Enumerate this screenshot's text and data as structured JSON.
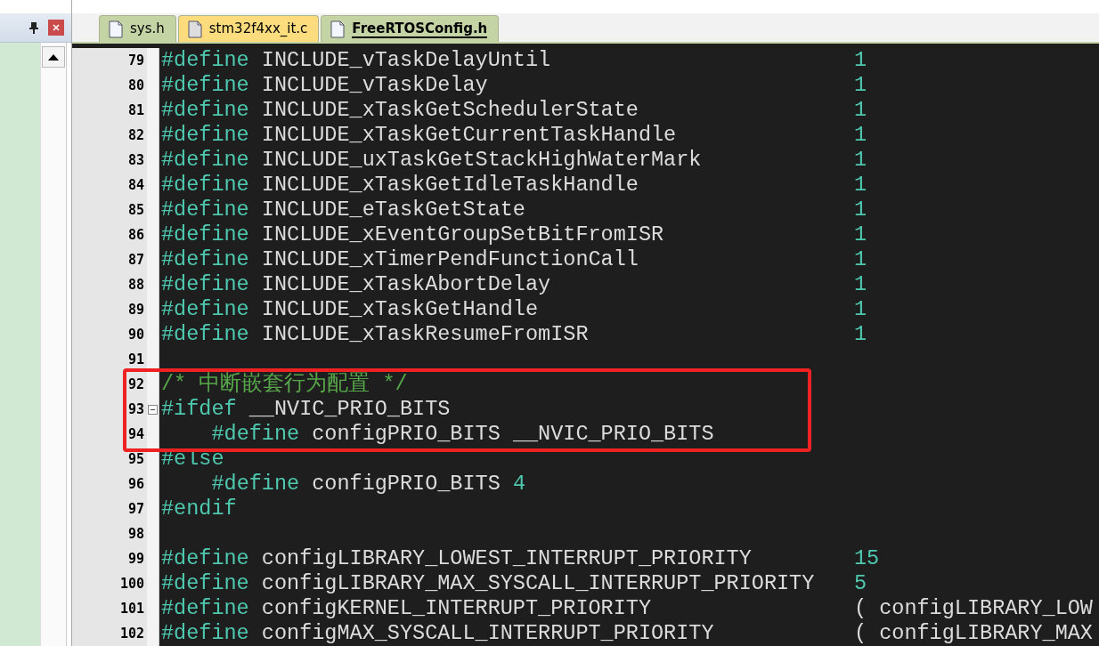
{
  "tabs": [
    {
      "label": "sys.h",
      "selected": false,
      "color": "#c4d4a4"
    },
    {
      "label": "stm32f4xx_it.c",
      "selected": false,
      "color": "#fcdc7c"
    },
    {
      "label": "FreeRTOSConfig.h",
      "selected": true,
      "color": "#c4d4a4"
    }
  ],
  "lines": [
    {
      "number": "79",
      "kind": "define",
      "directive": "#define",
      "name": "INCLUDE_vTaskDelayUntil",
      "value": "1",
      "indented": false,
      "value_inline": false
    },
    {
      "number": "80",
      "kind": "define",
      "directive": "#define",
      "name": "INCLUDE_vTaskDelay",
      "value": "1",
      "indented": false,
      "value_inline": false
    },
    {
      "number": "81",
      "kind": "define",
      "directive": "#define",
      "name": "INCLUDE_xTaskGetSchedulerState",
      "value": "1",
      "indented": false,
      "value_inline": false
    },
    {
      "number": "82",
      "kind": "define",
      "directive": "#define",
      "name": "INCLUDE_xTaskGetCurrentTaskHandle",
      "value": "1",
      "indented": false,
      "value_inline": false
    },
    {
      "number": "83",
      "kind": "define",
      "directive": "#define",
      "name": "INCLUDE_uxTaskGetStackHighWaterMark",
      "value": "1",
      "indented": false,
      "value_inline": false
    },
    {
      "number": "84",
      "kind": "define",
      "directive": "#define",
      "name": "INCLUDE_xTaskGetIdleTaskHandle",
      "value": "1",
      "indented": false,
      "value_inline": false
    },
    {
      "number": "85",
      "kind": "define",
      "directive": "#define",
      "name": "INCLUDE_eTaskGetState",
      "value": "1",
      "indented": false,
      "value_inline": false
    },
    {
      "number": "86",
      "kind": "define",
      "directive": "#define",
      "name": "INCLUDE_xEventGroupSetBitFromISR",
      "value": "1",
      "indented": false,
      "value_inline": false
    },
    {
      "number": "87",
      "kind": "define",
      "directive": "#define",
      "name": "INCLUDE_xTimerPendFunctionCall",
      "value": "1",
      "indented": false,
      "value_inline": false
    },
    {
      "number": "88",
      "kind": "define",
      "directive": "#define",
      "name": "INCLUDE_xTaskAbortDelay",
      "value": "1",
      "indented": false,
      "value_inline": false
    },
    {
      "number": "89",
      "kind": "define",
      "directive": "#define",
      "name": "INCLUDE_xTaskGetHandle",
      "value": "1",
      "indented": false,
      "value_inline": false
    },
    {
      "number": "90",
      "kind": "define",
      "directive": "#define",
      "name": "INCLUDE_xTaskResumeFromISR",
      "value": "1",
      "indented": false,
      "value_inline": false
    },
    {
      "number": "91",
      "kind": "blank"
    },
    {
      "number": "92",
      "kind": "comment",
      "text": "/* 中断嵌套行为配置 */",
      "box_start": true
    },
    {
      "number": "93",
      "kind": "define",
      "directive": "#ifdef",
      "name": "__NVIC_PRIO_BITS",
      "indented": false,
      "foldable": true
    },
    {
      "number": "94",
      "kind": "define",
      "directive": "#define",
      "name": "configPRIO_BITS __NVIC_PRIO_BITS",
      "indented": true,
      "box_end": true
    },
    {
      "number": "95",
      "kind": "define",
      "directive": "#else"
    },
    {
      "number": "96",
      "kind": "define",
      "directive": "#define",
      "name": "configPRIO_BITS",
      "value": "4",
      "indented": true,
      "value_inline": true
    },
    {
      "number": "97",
      "kind": "define",
      "directive": "#endif"
    },
    {
      "number": "98",
      "kind": "blank"
    },
    {
      "number": "99",
      "kind": "define",
      "directive": "#define",
      "name": "configLIBRARY_LOWEST_INTERRUPT_PRIORITY",
      "value": "15",
      "indented": false,
      "value_inline": false
    },
    {
      "number": "100",
      "kind": "define",
      "directive": "#define",
      "name": "configLIBRARY_MAX_SYSCALL_INTERRUPT_PRIORITY",
      "value": "5",
      "indented": false,
      "value_inline": false
    },
    {
      "number": "101",
      "kind": "define",
      "directive": "#define",
      "name": "configKERNEL_INTERRUPT_PRIORITY",
      "expression": "( configLIBRARY_LOW",
      "indented": false
    },
    {
      "number": "102",
      "kind": "define",
      "directive": "#define",
      "name": "configMAX_SYSCALL_INTERRUPT_PRIORITY",
      "expression": "( configLIBRARY_MAX",
      "indented": false
    }
  ]
}
